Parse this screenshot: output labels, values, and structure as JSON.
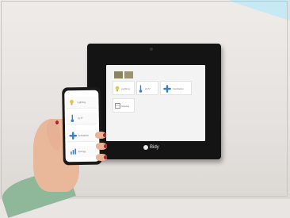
{
  "scene": {
    "description_colors": {
      "wall": "#e9e5e2",
      "panel_bezel": "#141414",
      "screen_bg": "#f3f3f3",
      "accent_blue": "#3a7fc4",
      "accent_olive": "#8a8360",
      "sleeve": "#8fb89a",
      "nail_polish": "#a8232e"
    }
  },
  "panel": {
    "brand": "Bidy",
    "tiles": [
      {
        "icon": "lightbulb-icon",
        "label": "Lighting"
      },
      {
        "icon": "thermometer-icon",
        "label": "21.5°"
      },
      {
        "icon": "fan-icon",
        "label": "Ventilation"
      },
      {
        "icon": "shades-icon",
        "label": "Shades"
      }
    ]
  },
  "phone": {
    "items": [
      {
        "icon": "lightbulb-icon",
        "label": "Lighting"
      },
      {
        "icon": "thermometer-icon",
        "label": "21.5°"
      },
      {
        "icon": "fan-icon",
        "label": "Ventilation"
      },
      {
        "icon": "chart-icon",
        "label": "Energy"
      }
    ]
  }
}
